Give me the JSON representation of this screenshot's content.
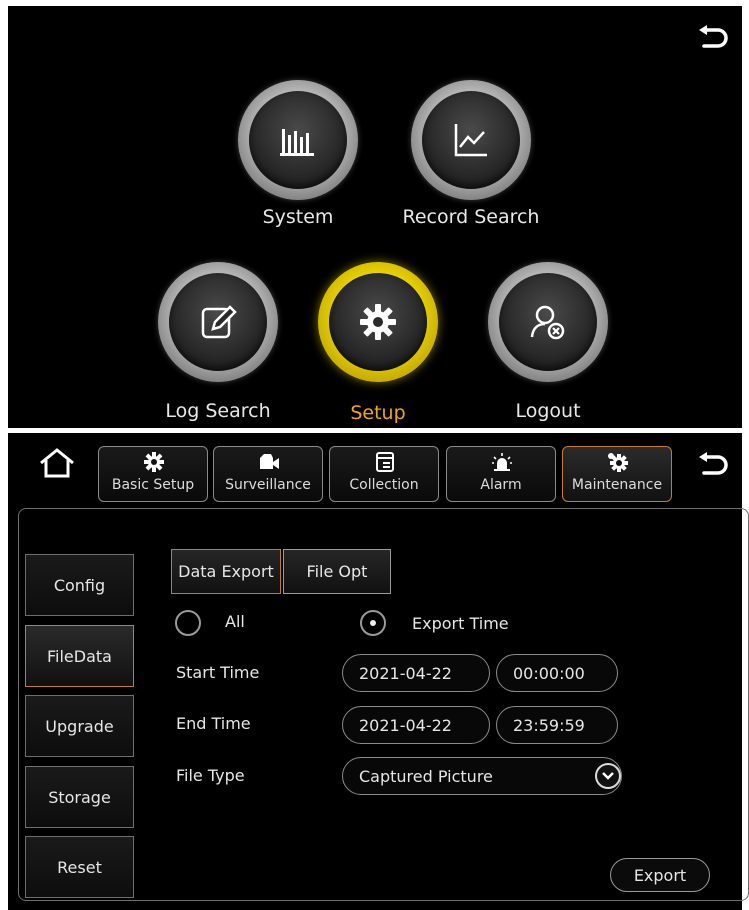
{
  "main_menu": {
    "items": [
      {
        "label": "System",
        "icon": "bar-chart-icon",
        "active": false
      },
      {
        "label": "Record Search",
        "icon": "line-chart-icon",
        "active": false
      },
      {
        "label": "Log Search",
        "icon": "edit-icon",
        "active": false
      },
      {
        "label": "Setup",
        "icon": "gear-icon",
        "active": true
      },
      {
        "label": "Logout",
        "icon": "logout-user-icon",
        "active": false
      }
    ],
    "colors": {
      "active_label": "#f2a900",
      "active_ring": "#f2e000"
    }
  },
  "setup": {
    "tabs": [
      {
        "label": "Basic Setup",
        "icon": "gear-icon"
      },
      {
        "label": "Surveillance",
        "icon": "camera-icon"
      },
      {
        "label": "Collection",
        "icon": "document-icon"
      },
      {
        "label": "Alarm",
        "icon": "alarm-icon"
      },
      {
        "label": "Maintenance",
        "icon": "maintenance-icon",
        "active": true
      }
    ],
    "sidebar": [
      {
        "label": "Config"
      },
      {
        "label": "FileData",
        "active": true
      },
      {
        "label": "Upgrade"
      },
      {
        "label": "Storage"
      },
      {
        "label": "Reset"
      }
    ],
    "subtabs": [
      {
        "label": "Data Export",
        "active": true
      },
      {
        "label": "File Opt"
      }
    ],
    "form": {
      "radio_all": "All",
      "radio_export_time": "Export Time",
      "selected_radio": "Export Time",
      "start_time_label": "Start Time",
      "start_date": "2021-04-22",
      "start_clock": "00:00:00",
      "end_time_label": "End Time",
      "end_date": "2021-04-22",
      "end_clock": "23:59:59",
      "file_type_label": "File Type",
      "file_type_value": "Captured Picture",
      "export_button": "Export"
    },
    "colors": {
      "active_border": "#c77a2a"
    }
  }
}
